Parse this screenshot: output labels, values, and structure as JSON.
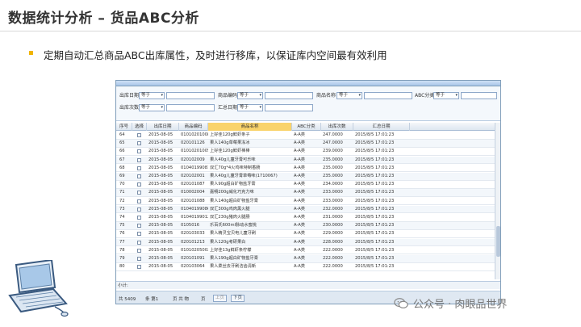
{
  "slide": {
    "title": "数据统计分析 – 货品ABC分析",
    "bullet_text": "定期自动汇总商品ABC出库属性，及时进行移库，以保证库内空间最有效利用",
    "bullet_color": "#f0b400"
  },
  "filters": {
    "row1": [
      {
        "label": "出库日期",
        "op": "等于"
      },
      {
        "label": "商品编码",
        "op": "等于"
      },
      {
        "label": "商品名称",
        "op": "等于"
      },
      {
        "label": "ABC分类",
        "op": "等于"
      }
    ],
    "row2": [
      {
        "label": "出库次数",
        "op": "等于"
      },
      {
        "label": "汇总日期",
        "op": "等于"
      }
    ]
  },
  "table": {
    "columns": [
      "序号",
      "选择",
      "出库日期",
      "商品编码",
      "商品名称",
      "ABC分类",
      "出库次数",
      "汇总日期"
    ],
    "active_column": "商品名称",
    "rows": [
      [
        "64",
        "2015-08-05",
        "01010201008",
        "上好佳120g鲜虾条子",
        "A-A类",
        "247.0000",
        "2015/8/5 17:01:23"
      ],
      [
        "65",
        "2015-08-05",
        "020101126",
        "果人140g草莓果冻冰",
        "A-A类",
        "247.0000",
        "2015/8/5 17:01:23"
      ],
      [
        "66",
        "2015-08-05",
        "01010201005",
        "上好佳120g鲜虾棒棒",
        "A-A类",
        "239.0000",
        "2015/8/5 17:01:23"
      ],
      [
        "67",
        "2015-08-05",
        "020102009",
        "果人40g儿童牙膏可乐味",
        "A-A类",
        "235.0000",
        "2015/8/5 17:01:23"
      ],
      [
        "68",
        "2015-08-05",
        "01040199081",
        "双汇70g*4火鸡味特制香肠",
        "A-A类",
        "235.0000",
        "2015/8/5 17:01:23"
      ],
      [
        "69",
        "2015-08-05",
        "020102001",
        "果人40g儿童牙膏草莓味(1710067)",
        "A-A类",
        "235.0000",
        "2015/8/5 17:01:23"
      ],
      [
        "70",
        "2015-08-05",
        "020101087",
        "果人90g超白矿物盐牙膏",
        "A-A类",
        "234.0000",
        "2015/8/5 17:01:23"
      ],
      [
        "71",
        "2015-08-05",
        "010002004",
        "嘉畅200g威化巧克力味",
        "A-A类",
        "233.0000",
        "2015/8/5 17:01:23"
      ],
      [
        "72",
        "2015-08-05",
        "020101088",
        "果人140g超白矿物盐牙膏",
        "A-A类",
        "233.0000",
        "2015/8/5 17:01:23"
      ],
      [
        "73",
        "2015-08-05",
        "01040199086",
        "双汇300g鸡肉黑火腿",
        "A-A类",
        "232.0000",
        "2015/8/5 17:01:23"
      ],
      [
        "74",
        "2015-08-05",
        "01040199012",
        "双汇230g猪肉火腿肠",
        "A-A类",
        "231.0000",
        "2015/8/5 17:01:23"
      ],
      [
        "75",
        "2015-08-05",
        "0105016",
        "乐百氏600ml脉动水蜜桃",
        "A-A类",
        "230.0000",
        "2015/8/5 17:01:23"
      ],
      [
        "76",
        "2015-08-05",
        "020103033",
        "果人精灵宝贝电儿童牙刷",
        "A-A类",
        "229.0000",
        "2015/8/5 17:01:23"
      ],
      [
        "77",
        "2015-08-05",
        "020101213",
        "果人120g考研果白",
        "A-A类",
        "228.0000",
        "2015/8/5 17:01:23"
      ],
      [
        "78",
        "2015-08-05",
        "01010205002",
        "上好佳13g鲜虾条柠檬",
        "A-A类",
        "222.0000",
        "2015/8/5 17:01:23"
      ],
      [
        "79",
        "2015-08-05",
        "020101091",
        "果人190g超白矿物盐牙膏",
        "A-A类",
        "222.0000",
        "2015/8/5 17:01:23"
      ],
      [
        "80",
        "2015-08-05",
        "020103064",
        "果人柔丝去牙刷洁齿清新",
        "A-A类",
        "222.0000",
        "2015/8/5 17:01:23"
      ]
    ]
  },
  "summary_label": "小计:",
  "pager": {
    "total": "共 5409",
    "page_prefix": "条 第1",
    "page_suffix": "页 共 物",
    "page_total": "页",
    "prev_label": "上页",
    "next_label": "下页"
  },
  "watermark": "公众号 · 肉眼品世界"
}
